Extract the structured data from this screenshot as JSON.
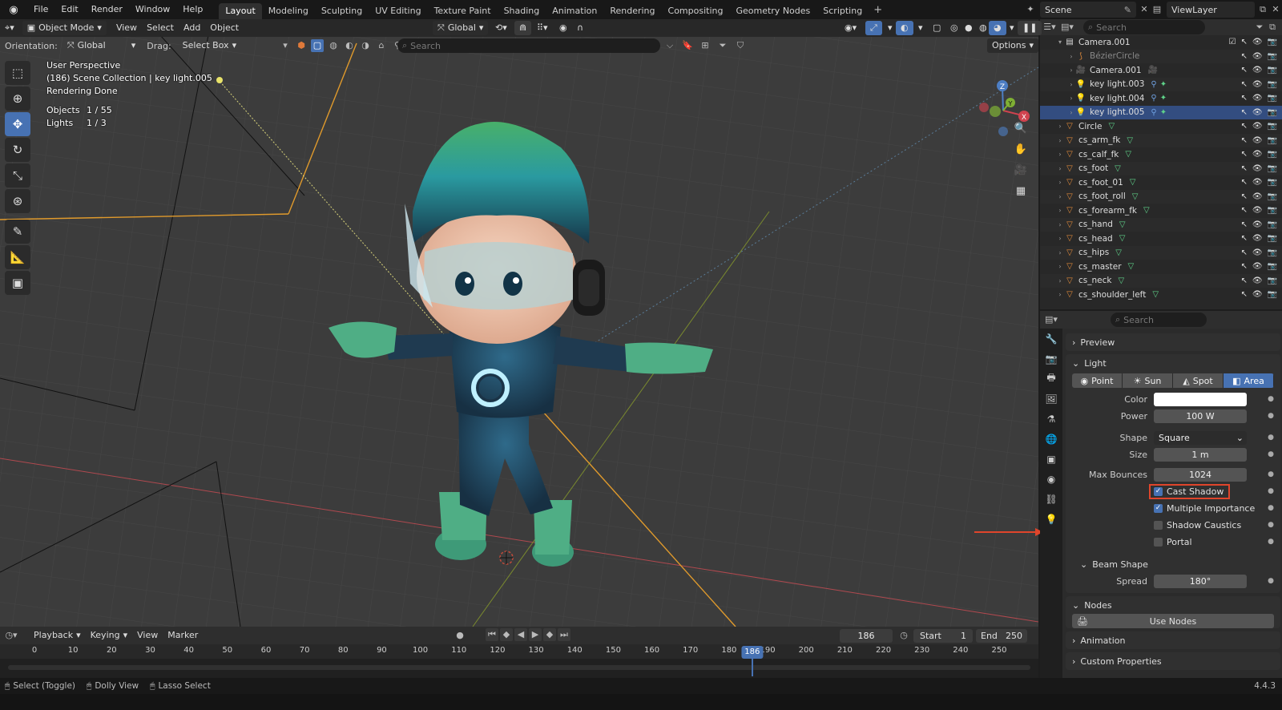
{
  "menubar": {
    "menus": [
      "File",
      "Edit",
      "Render",
      "Window",
      "Help"
    ],
    "workspaces": [
      {
        "label": "Layout",
        "active": true
      },
      {
        "label": "Modeling"
      },
      {
        "label": "Sculpting"
      },
      {
        "label": "UV Editing"
      },
      {
        "label": "Texture Paint"
      },
      {
        "label": "Shading"
      },
      {
        "label": "Animation"
      },
      {
        "label": "Rendering"
      },
      {
        "label": "Compositing"
      },
      {
        "label": "Geometry Nodes"
      },
      {
        "label": "Scripting"
      }
    ],
    "add_workspace": "+",
    "scene": "Scene",
    "view_layer": "ViewLayer"
  },
  "viewport_header": {
    "mode": "Object Mode",
    "menus": [
      "View",
      "Select",
      "Add",
      "Object"
    ],
    "transform_orientation": "Global",
    "options": "Options"
  },
  "tool_settings": {
    "orientation_label": "Orientation:",
    "orientation_value": "Global",
    "drag_label": "Drag:",
    "drag_value": "Select Box",
    "search_placeholder": "Search"
  },
  "viewport_overlay": {
    "view_name": "User Perspective",
    "context": "(186) Scene Collection | key light.005",
    "status": "Rendering Done",
    "objects_label": "Objects",
    "objects_value": "1 / 55",
    "lights_label": "Lights",
    "lights_value": "1 / 3"
  },
  "gizmo": {
    "x": "X",
    "y": "Y",
    "z": "Z"
  },
  "outliner": {
    "search_placeholder": "Search",
    "rows": [
      {
        "name": "Camera.001",
        "indent": 1,
        "icon": "collection-icon",
        "expanded": true
      },
      {
        "name": "BézierCircle",
        "indent": 2,
        "icon": "curve-icon",
        "dim": true
      },
      {
        "name": "Camera.001",
        "indent": 2,
        "icon": "camera-icon"
      },
      {
        "name": "key light.003",
        "indent": 2,
        "icon": "light-icon"
      },
      {
        "name": "key light.004",
        "indent": 2,
        "icon": "light-icon"
      },
      {
        "name": "key light.005",
        "indent": 2,
        "icon": "light-icon",
        "selected": true
      },
      {
        "name": "Circle",
        "indent": 1,
        "icon": "mesh-icon"
      },
      {
        "name": "cs_arm_fk",
        "indent": 1,
        "icon": "mesh-icon"
      },
      {
        "name": "cs_calf_fk",
        "indent": 1,
        "icon": "mesh-icon"
      },
      {
        "name": "cs_foot",
        "indent": 1,
        "icon": "mesh-icon"
      },
      {
        "name": "cs_foot_01",
        "indent": 1,
        "icon": "mesh-icon"
      },
      {
        "name": "cs_foot_roll",
        "indent": 1,
        "icon": "mesh-icon"
      },
      {
        "name": "cs_forearm_fk",
        "indent": 1,
        "icon": "mesh-icon"
      },
      {
        "name": "cs_hand",
        "indent": 1,
        "icon": "mesh-icon"
      },
      {
        "name": "cs_head",
        "indent": 1,
        "icon": "mesh-icon"
      },
      {
        "name": "cs_hips",
        "indent": 1,
        "icon": "mesh-icon"
      },
      {
        "name": "cs_master",
        "indent": 1,
        "icon": "mesh-icon"
      },
      {
        "name": "cs_neck",
        "indent": 1,
        "icon": "mesh-icon"
      },
      {
        "name": "cs_shoulder_left",
        "indent": 1,
        "icon": "mesh-icon"
      }
    ]
  },
  "properties": {
    "search_placeholder": "Search",
    "preview": "Preview",
    "light_panel": "Light",
    "light_types": [
      {
        "label": "Point"
      },
      {
        "label": "Sun"
      },
      {
        "label": "Spot"
      },
      {
        "label": "Area",
        "active": true
      }
    ],
    "color_label": "Color",
    "color_value": "#ffffff",
    "power_label": "Power",
    "power_value": "100 W",
    "shape_label": "Shape",
    "shape_value": "Square",
    "size_label": "Size",
    "size_value": "1 m",
    "max_bounces_label": "Max Bounces",
    "max_bounces_value": "1024",
    "cast_shadow": "Cast Shadow",
    "cast_shadow_checked": true,
    "multiple_importance": "Multiple Importance",
    "multiple_importance_checked": true,
    "shadow_caustics": "Shadow Caustics",
    "shadow_caustics_checked": false,
    "portal": "Portal",
    "portal_checked": false,
    "beam_shape": "Beam Shape",
    "spread_label": "Spread",
    "spread_value": "180°",
    "nodes": "Nodes",
    "use_nodes": "Use Nodes",
    "animation": "Animation",
    "custom_properties": "Custom Properties"
  },
  "timeline": {
    "menus": [
      "Playback",
      "Keying",
      "View",
      "Marker"
    ],
    "current_frame": "186",
    "start_label": "Start",
    "start_value": "1",
    "end_label": "End",
    "end_value": "250",
    "ticks": [
      "0",
      "10",
      "20",
      "30",
      "40",
      "50",
      "60",
      "70",
      "80",
      "90",
      "100",
      "110",
      "120",
      "130",
      "140",
      "150",
      "160",
      "170",
      "180",
      "190",
      "200",
      "210",
      "220",
      "230",
      "240",
      "250"
    ],
    "playhead": "186"
  },
  "statusbar": {
    "hints": [
      "Select (Toggle)",
      "Dolly View",
      "Lasso Select"
    ],
    "version": "4.4.3"
  },
  "colors": {
    "accent": "#4772b3",
    "highlight_box": "#e0452b",
    "arrow": "#e0452b",
    "green_icon": "#5fd38a"
  }
}
